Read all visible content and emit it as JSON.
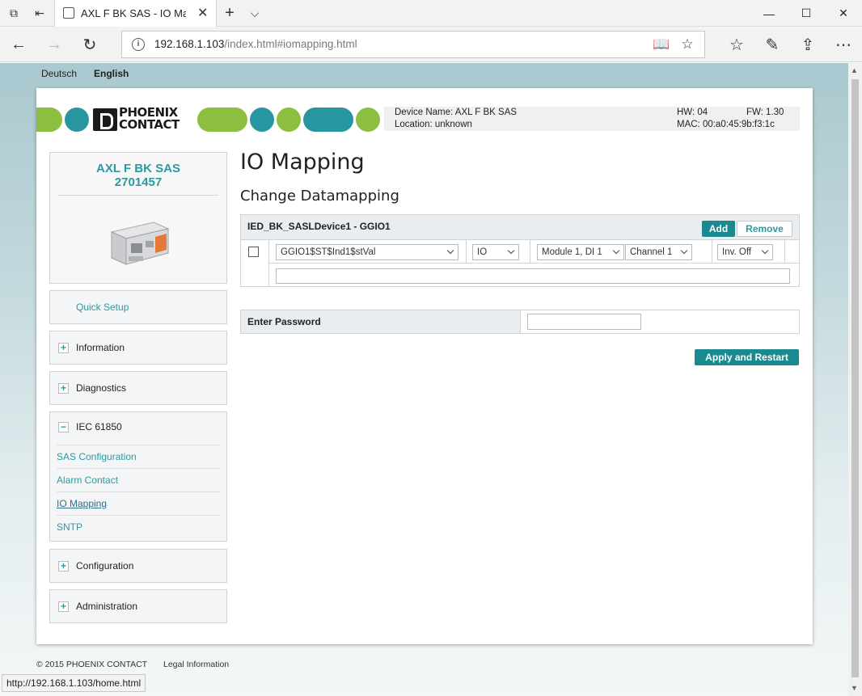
{
  "browser": {
    "tab_title": "AXL F BK SAS - IO Mapp",
    "url_host": "192.168.1.103",
    "url_path": "/index.html#iomapping.html",
    "status_url": "http://192.168.1.103/home.html"
  },
  "languages": [
    "Deutsch",
    "English"
  ],
  "header": {
    "logo_text": "PHOENIX\nCONTACT",
    "device_name": "Device Name: AXL F BK SAS",
    "location": "Location: unknown",
    "hw": "HW: 04",
    "fw": "FW: 1.30",
    "mac": "MAC: 00:a0:45:9b:f3:1c",
    "colors": {
      "green": "#8cbf3f",
      "teal": "#2796a0"
    }
  },
  "sidebar": {
    "device_title": "AXL F BK SAS",
    "device_number": "2701457",
    "quick_setup": "Quick Setup",
    "menus": [
      "Information",
      "Diagnostics",
      "IEC 61850",
      "Configuration",
      "Administration"
    ],
    "iec_items": [
      "SAS Configuration",
      "Alarm Contact",
      "IO Mapping",
      "SNTP"
    ]
  },
  "main": {
    "title": "IO Mapping",
    "subtitle": "Change Datamapping",
    "table_title": "IED_BK_SASLDevice1 - GGIO1",
    "add_label": "Add",
    "remove_label": "Remove",
    "row": {
      "checked": false,
      "signal": "GGIO1$ST$Ind1$stVal",
      "type": "IO",
      "module": "Module 1, DI 1",
      "channel": "Channel 1",
      "invert": "Inv. Off",
      "text_value": ""
    },
    "password_label": "Enter Password",
    "password_value": "",
    "apply_label": "Apply and Restart"
  },
  "footer": {
    "copyright": "© 2015 PHOENIX CONTACT",
    "legal": "Legal Information"
  }
}
